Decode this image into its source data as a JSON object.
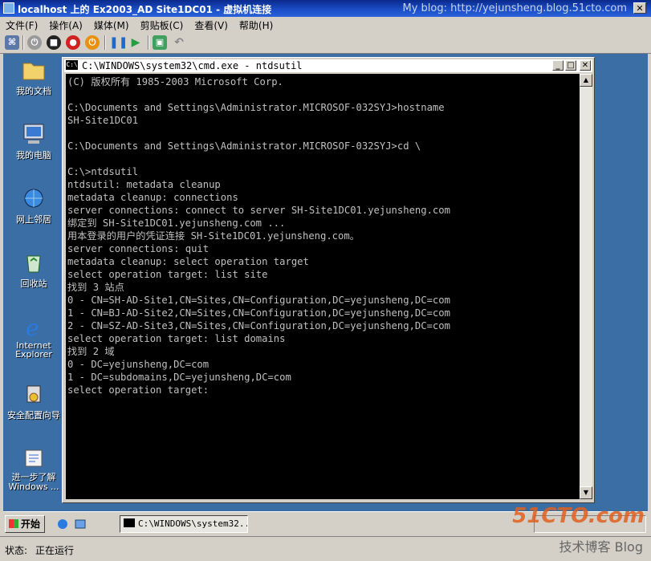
{
  "window": {
    "title": "localhost 上的 Ex2003_AD Site1DC01 - 虚拟机连接",
    "watermark": "My blog: http://yejunsheng.blog.51cto.com"
  },
  "menu": [
    "文件(F)",
    "操作(A)",
    "媒体(M)",
    "剪贴板(C)",
    "查看(V)",
    "帮助(H)"
  ],
  "toolbar_icons": [
    "ctrl-alt-del-icon",
    "start-icon",
    "turn-off-icon",
    "shutdown-icon",
    "reset-icon",
    "pause-icon",
    "resume-icon",
    "snapshot-icon",
    "revert-icon"
  ],
  "desktop_icons": [
    {
      "label": "我的文档",
      "icon": "folder-icon"
    },
    {
      "label": "我的电脑",
      "icon": "computer-icon"
    },
    {
      "label": "网上邻居",
      "icon": "network-icon"
    },
    {
      "label": "回收站",
      "icon": "recycle-bin-icon"
    },
    {
      "label": "Internet Explorer",
      "icon": "ie-icon"
    },
    {
      "label": "安全配置向导",
      "icon": "security-wizard-icon"
    },
    {
      "label": "进一步了解 Windows ...",
      "icon": "learn-icon"
    }
  ],
  "cmd": {
    "title": "C:\\WINDOWS\\system32\\cmd.exe - ntdsutil",
    "lines": [
      "(C) 版权所有 1985-2003 Microsoft Corp.",
      "",
      "C:\\Documents and Settings\\Administrator.MICROSOF-032SYJ>hostname",
      "SH-Site1DC01",
      "",
      "C:\\Documents and Settings\\Administrator.MICROSOF-032SYJ>cd \\",
      "",
      "C:\\>ntdsutil",
      "ntdsutil: metadata cleanup",
      "metadata cleanup: connections",
      "server connections: connect to server SH-Site1DC01.yejunsheng.com",
      "绑定到 SH-Site1DC01.yejunsheng.com ...",
      "用本登录的用户的凭证连接 SH-Site1DC01.yejunsheng.com。",
      "server connections: quit",
      "metadata cleanup: select operation target",
      "select operation target: list site",
      "找到 3 站点",
      "0 - CN=SH-AD-Site1,CN=Sites,CN=Configuration,DC=yejunsheng,DC=com",
      "1 - CN=BJ-AD-Site2,CN=Sites,CN=Configuration,DC=yejunsheng,DC=com",
      "2 - CN=SZ-AD-Site3,CN=Sites,CN=Configuration,DC=yejunsheng,DC=com",
      "select operation target: list domains",
      "找到 2 域",
      "0 - DC=yejunsheng,DC=com",
      "1 - DC=subdomains,DC=yejunsheng,DC=com",
      "select operation target:"
    ]
  },
  "taskbar": {
    "start": "开始",
    "task_item": "C:\\WINDOWS\\system32..."
  },
  "status": {
    "label": "状态:",
    "value": "正在运行"
  },
  "watermark_bottom": "51CTO.com",
  "watermark_bottom_sub": "技术博客 Blog"
}
